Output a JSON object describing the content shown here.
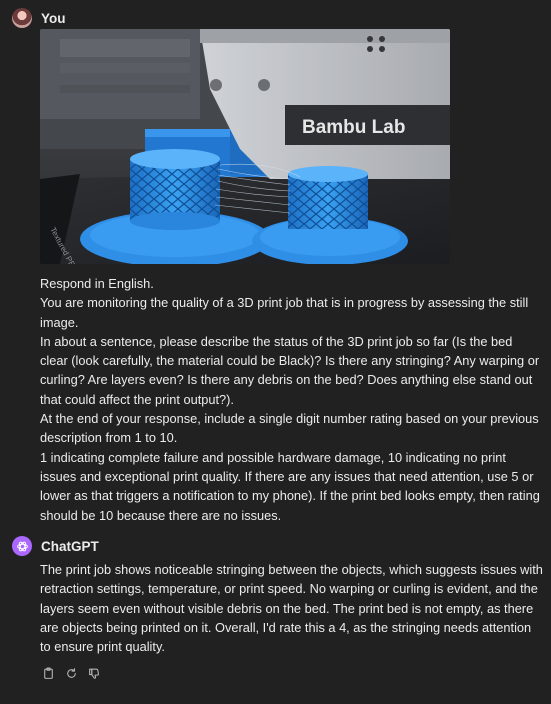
{
  "user": {
    "name": "You",
    "image": {
      "brand_text": "Bambu Lab",
      "plate_text": "Textured PEI Plate"
    },
    "paragraphs": [
      "Respond in English.",
      "You are monitoring the quality of a 3D print job that is in progress by assessing the still image.",
      "In about a sentence, please describe the status of the 3D print job so far (Is the bed clear (look carefully, the material could be Black)? Is there any stringing? Any warping or curling? Are layers even? Is there any debris on the bed? Does anything else stand out that could affect the print output?).",
      "At the end of your response, include a single digit number rating based on your previous description from 1 to 10.",
      "1 indicating complete failure and possible hardware damage, 10 indicating no print issues and exceptional print quality. If there are any issues that need attention, use 5 or lower as that triggers a notification to my phone). If the print bed looks empty, then rating should be 10 because there are no issues."
    ]
  },
  "assistant": {
    "name": "ChatGPT",
    "response": "The print job shows noticeable stringing between the objects, which suggests issues with retraction settings, temperature, or print speed. No warping or curling is evident, and the layers seem even without visible debris on the bed. The print bed is not empty, as there are objects being printed on it. Overall, I'd rate this a 4, as the stringing needs attention to ensure print quality."
  },
  "actions": [
    "clipboard-icon",
    "regenerate-icon",
    "thumbs-down-icon"
  ],
  "colors": {
    "background": "#212121",
    "text": "#ececec",
    "icon": "#b4b4b4",
    "bot_avatar": "#ab68ff",
    "filament": "#2a8fe8"
  }
}
